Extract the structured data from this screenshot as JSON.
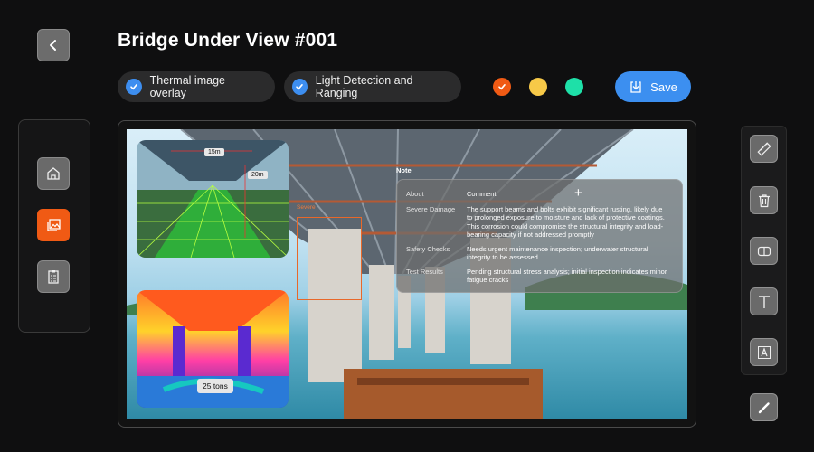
{
  "header": {
    "title": "Bridge Under View #001",
    "back_icon": "chevron-left-icon"
  },
  "toolbar": {
    "overlays": [
      {
        "label": "Thermal image overlay",
        "checked": true
      },
      {
        "label": "Light Detection and Ranging",
        "checked": true
      }
    ],
    "colors": [
      {
        "hex": "#f05a14",
        "selected": true
      },
      {
        "hex": "#f7c948",
        "selected": false
      },
      {
        "hex": "#1ee0a8",
        "selected": false
      }
    ],
    "save_label": "Save"
  },
  "sidebar": {
    "items": [
      {
        "icon": "home-icon",
        "active": false
      },
      {
        "icon": "image-gallery-icon",
        "active": true
      },
      {
        "icon": "clipboard-list-icon",
        "active": false
      }
    ]
  },
  "tools": {
    "items": [
      {
        "icon": "ruler-icon"
      },
      {
        "icon": "trash-icon"
      },
      {
        "icon": "compare-icon"
      },
      {
        "icon": "text-icon"
      },
      {
        "icon": "text-box-icon"
      }
    ],
    "pencil_icon": "pencil-icon"
  },
  "viewer": {
    "lidar_labels": {
      "width": "15m",
      "height": "20m"
    },
    "thermal_label": "25 tons",
    "annotation_label": "Severe",
    "note": {
      "title": "Note",
      "header_key": "About",
      "header_value": "Comment",
      "rows": [
        {
          "key": "Severe Damage",
          "value": "The support beams and bolts exhibit significant rusting, likely due to prolonged exposure to moisture and lack of protective coatings. This corrosion could compromise the structural integrity and load-bearing capacity if not addressed promptly"
        },
        {
          "key": "Safety Checks",
          "value": "Needs urgent maintenance inspection; underwater structural integrity to be assessed"
        },
        {
          "key": "Test Results",
          "value": "Pending structural stress analysis; initial inspection indicates minor fatigue cracks"
        }
      ]
    }
  }
}
